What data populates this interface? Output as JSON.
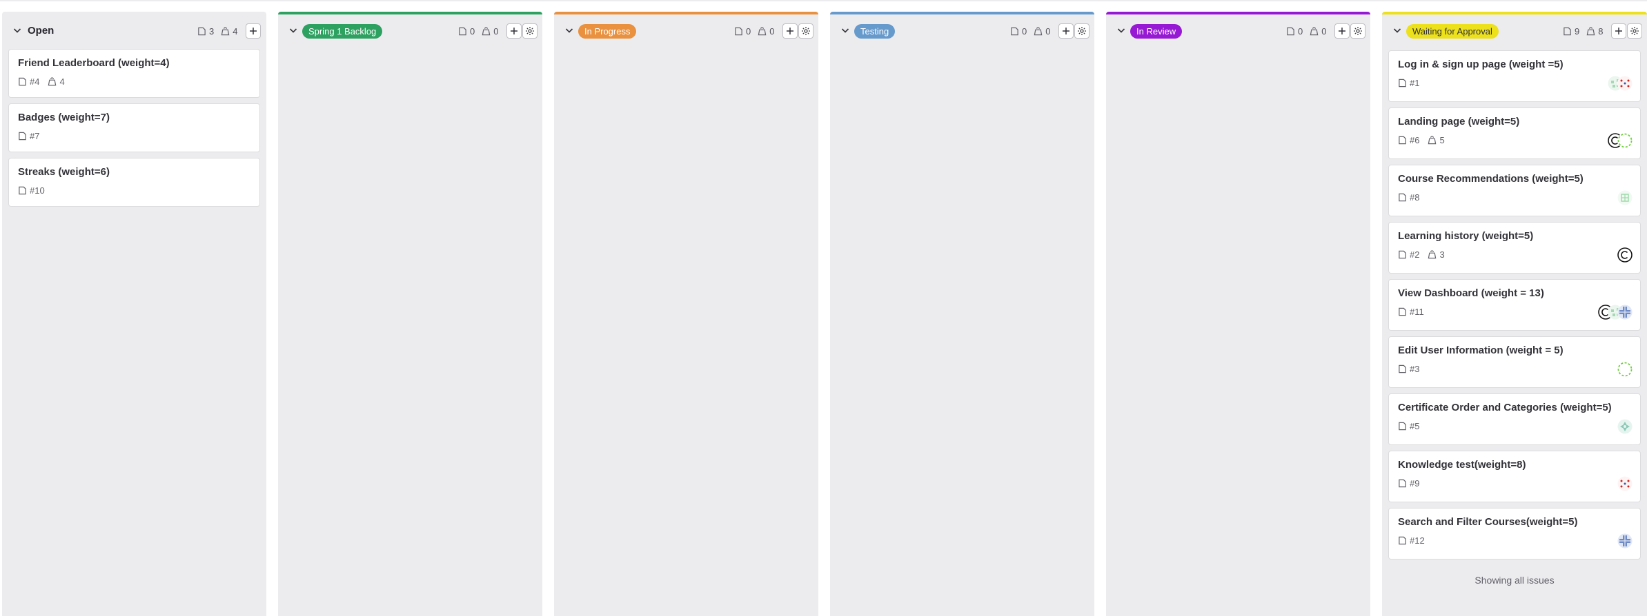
{
  "colors": {
    "board_bg": "#ececef",
    "spring_backlog": "#2da160",
    "in_progress": "#e9913e",
    "testing": "#6699cc",
    "in_review": "#9719d4",
    "waiting": "#ece11a"
  },
  "columns": [
    {
      "title": "Open",
      "issue_count": "3",
      "weight": "4",
      "cards": [
        {
          "title": "Friend Leaderboard (weight=4)",
          "ref": "#4",
          "weight": "4",
          "avatars": []
        },
        {
          "title": "Badges (weight=7)",
          "ref": "#7",
          "weight": "",
          "avatars": []
        },
        {
          "title": "Streaks (weight=6)",
          "ref": "#10",
          "weight": "",
          "avatars": []
        }
      ]
    },
    {
      "title": "Spring 1 Backlog",
      "issue_count": "0",
      "weight": "0",
      "cards": []
    },
    {
      "title": "In Progress",
      "issue_count": "0",
      "weight": "0",
      "cards": []
    },
    {
      "title": "Testing",
      "issue_count": "0",
      "weight": "0",
      "cards": []
    },
    {
      "title": "In Review",
      "issue_count": "0",
      "weight": "0",
      "cards": []
    },
    {
      "title": "Waiting for Approval",
      "issue_count": "9",
      "weight": "8",
      "footer": "Showing all issues",
      "cards": [
        {
          "title": "Log in & sign up page (weight =5)",
          "ref": "#1",
          "weight": "",
          "avatars": [
            "green-pattern-avatar",
            "red-dots-avatar"
          ]
        },
        {
          "title": "Landing page (weight=5)",
          "ref": "#6",
          "weight": "5",
          "avatars": [
            "c-circle-avatar",
            "green-ring-avatar"
          ]
        },
        {
          "title": "Course Recommendations (weight=5)",
          "ref": "#8",
          "weight": "",
          "avatars": [
            "green-grid-avatar"
          ]
        },
        {
          "title": "Learning history (weight=5)",
          "ref": "#2",
          "weight": "3",
          "avatars": [
            "c-circle-avatar"
          ]
        },
        {
          "title": "View Dashboard (weight = 13)",
          "ref": "#11",
          "weight": "",
          "avatars": [
            "c-circle-avatar",
            "green-pattern-avatar",
            "blue-cross-avatar"
          ]
        },
        {
          "title": "Edit User Information (weight = 5)",
          "ref": "#3",
          "weight": "",
          "avatars": [
            "green-ring-avatar"
          ]
        },
        {
          "title": "Certificate Order and Categories (weight=5)",
          "ref": "#5",
          "weight": "",
          "avatars": [
            "teal-pattern-avatar"
          ]
        },
        {
          "title": "Knowledge test(weight=8)",
          "ref": "#9",
          "weight": "",
          "avatars": [
            "red-dots-avatar"
          ]
        },
        {
          "title": "Search and Filter Courses(weight=5)",
          "ref": "#12",
          "weight": "",
          "avatars": [
            "blue-cross-avatar"
          ]
        }
      ]
    }
  ]
}
